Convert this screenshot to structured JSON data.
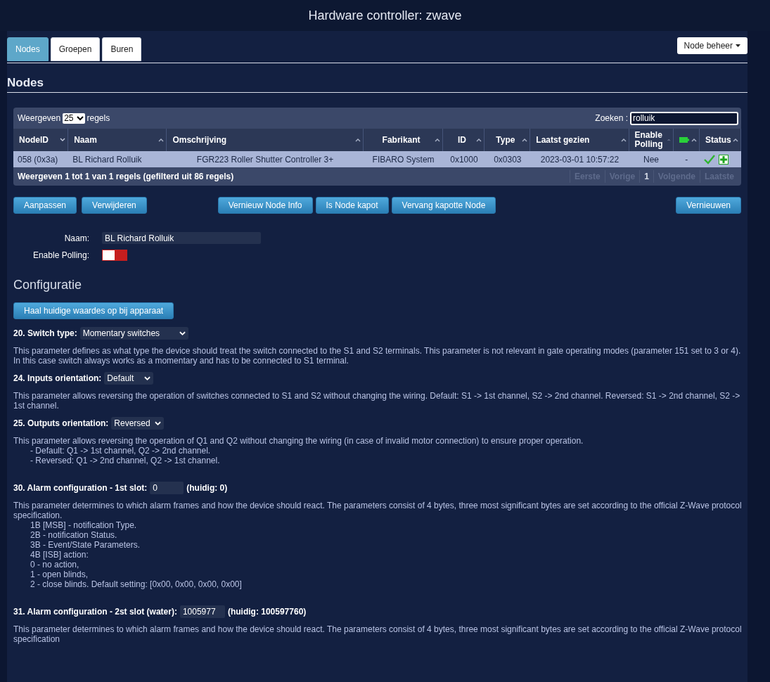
{
  "header": {
    "title": "Hardware controller: zwave"
  },
  "tabs": [
    {
      "label": "Nodes",
      "selected": true
    },
    {
      "label": "Groepen",
      "selected": false
    },
    {
      "label": "Buren",
      "selected": false
    }
  ],
  "node_menu": {
    "label": "Node beheer"
  },
  "section_title": "Nodes",
  "table": {
    "length_before": "Weergeven",
    "length_value": "25",
    "length_after": "regels",
    "search_label": "Zoeken :",
    "search_value": "rolluik",
    "columns": [
      {
        "label": "NodeID",
        "sorted": true
      },
      {
        "label": "Naam",
        "sorted": false
      },
      {
        "label": "Omschrijving",
        "sorted": false
      },
      {
        "label": "Fabrikant",
        "sorted": false
      },
      {
        "label": "ID",
        "sorted": false
      },
      {
        "label": "Type",
        "sorted": false
      },
      {
        "label": "Laatst gezien",
        "sorted": false
      },
      {
        "label": "Enable Polling",
        "sorted": false
      },
      {
        "kind": "battery",
        "sorted": false
      },
      {
        "label": "Status",
        "sorted": false
      }
    ],
    "rows": [
      {
        "selected": true,
        "cells": [
          "058 (0x3a)",
          "BL Richard Rolluik",
          "FGR223 Roller Shutter Controller 3+",
          "FIBARO System",
          "0x1000",
          "0x0303",
          "2023-03-01 10:57:22",
          "Nee",
          "-"
        ]
      }
    ],
    "info": "Weergeven 1 tot 1 van 1 regels (gefilterd uit 86 regels)",
    "pagination": [
      {
        "label": "Eerste",
        "disabled": true
      },
      {
        "label": "Vorige",
        "disabled": true
      },
      {
        "label": "1",
        "disabled": false
      },
      {
        "label": "Volgende",
        "disabled": true
      },
      {
        "label": "Laatste",
        "disabled": true
      }
    ]
  },
  "actions": {
    "left": [
      "Aanpassen",
      "Verwijderen"
    ],
    "middle": [
      "Vernieuw Node Info",
      "Is Node kapot",
      "Vervang kapotte Node"
    ],
    "right": [
      "Vernieuwen"
    ]
  },
  "form": {
    "name_label": "Naam:",
    "name_value": "BL Richard Rolluik",
    "polling_label": "Enable Polling:",
    "polling_on": false
  },
  "config": {
    "title": "Configuratie",
    "fetch_button": "Haal huidige waardes op bij apparaat",
    "params": [
      {
        "label": "20. Switch type:",
        "kind": "select",
        "value": "Momentary switches",
        "description": "This parameter defines as what type the device should treat the switch connected to the S1 and S2 terminals. This parameter is not relevant in gate operating modes (parameter 151 set to 3 or 4). In this case switch always works as a momentary and has to be connected to S1 terminal."
      },
      {
        "label": "24. Inputs orientation:",
        "kind": "select",
        "value": "Default",
        "description": "This parameter allows reversing the operation of switches connected to S1 and S2 without changing the wiring. Default: S1 -> 1st channel, S2 -> 2nd channel. Reversed: S1 -> 2nd channel, S2 -> 1st channel."
      },
      {
        "label": "25. Outputs orientation:",
        "kind": "select",
        "value": "Reversed",
        "description": "This parameter allows reversing the operation of Q1 and Q2 without changing the wiring (in case of invalid motor connection) to ensure proper operation.",
        "details": [
          "- Default: Q1 -> 1st channel, Q2 -> 2nd channel.",
          "- Reversed: Q1 -> 2nd channel, Q2 -> 1st channel."
        ]
      },
      {
        "label": "30. Alarm configuration - 1st slot:",
        "kind": "number",
        "value": "0",
        "current": "(huidig: 0)",
        "description": "This parameter determines to which alarm frames and how the device should react. The parameters consist of 4 bytes, three most significant bytes are set according to the official Z-Wave protocol specification.",
        "details": [
          "1B [MSB] - notification Type.",
          "2B - notification Status.",
          "3B - Event/State Parameters.",
          "4B [ISB] action:",
          "0 - no action,",
          "1 - open blinds,",
          "2 - close blinds. Default setting: [0x00, 0x00, 0x00, 0x00]"
        ]
      },
      {
        "label": "31. Alarm configuration - 2st slot (water):",
        "kind": "number",
        "value": "1005977",
        "current": "(huidig: 100597760)",
        "description": "This parameter determines to which alarm frames and how the device should react. The parameters consist of 4 bytes, three most significant bytes are set according to the official Z-Wave protocol specification"
      }
    ]
  }
}
